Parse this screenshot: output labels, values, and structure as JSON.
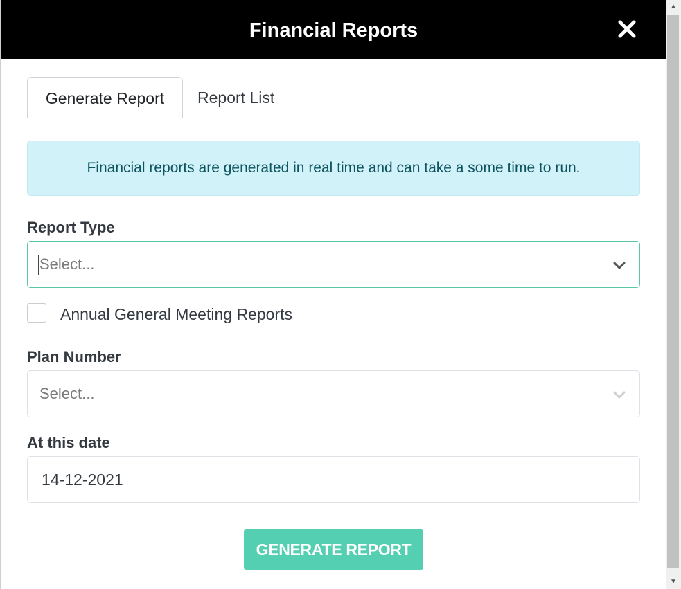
{
  "modal": {
    "title": "Financial Reports",
    "close_icon": "close-icon"
  },
  "tabs": [
    {
      "label": "Generate Report",
      "active": true
    },
    {
      "label": "Report List",
      "active": false
    }
  ],
  "alert": {
    "text": "Financial reports are generated in real time and can take a some time to run."
  },
  "form": {
    "report_type": {
      "label": "Report Type",
      "placeholder": "Select...",
      "focused": true
    },
    "agm_checkbox": {
      "label": "Annual General Meeting Reports",
      "checked": false
    },
    "plan_number": {
      "label": "Plan Number",
      "placeholder": "Select..."
    },
    "date": {
      "label": "At this date",
      "value": "14-12-2021"
    },
    "submit_label": "GENERATE REPORT"
  },
  "colors": {
    "header_bg": "#000000",
    "accent": "#55cfb1",
    "alert_bg": "#d1f2f8",
    "alert_text": "#0d5360"
  }
}
